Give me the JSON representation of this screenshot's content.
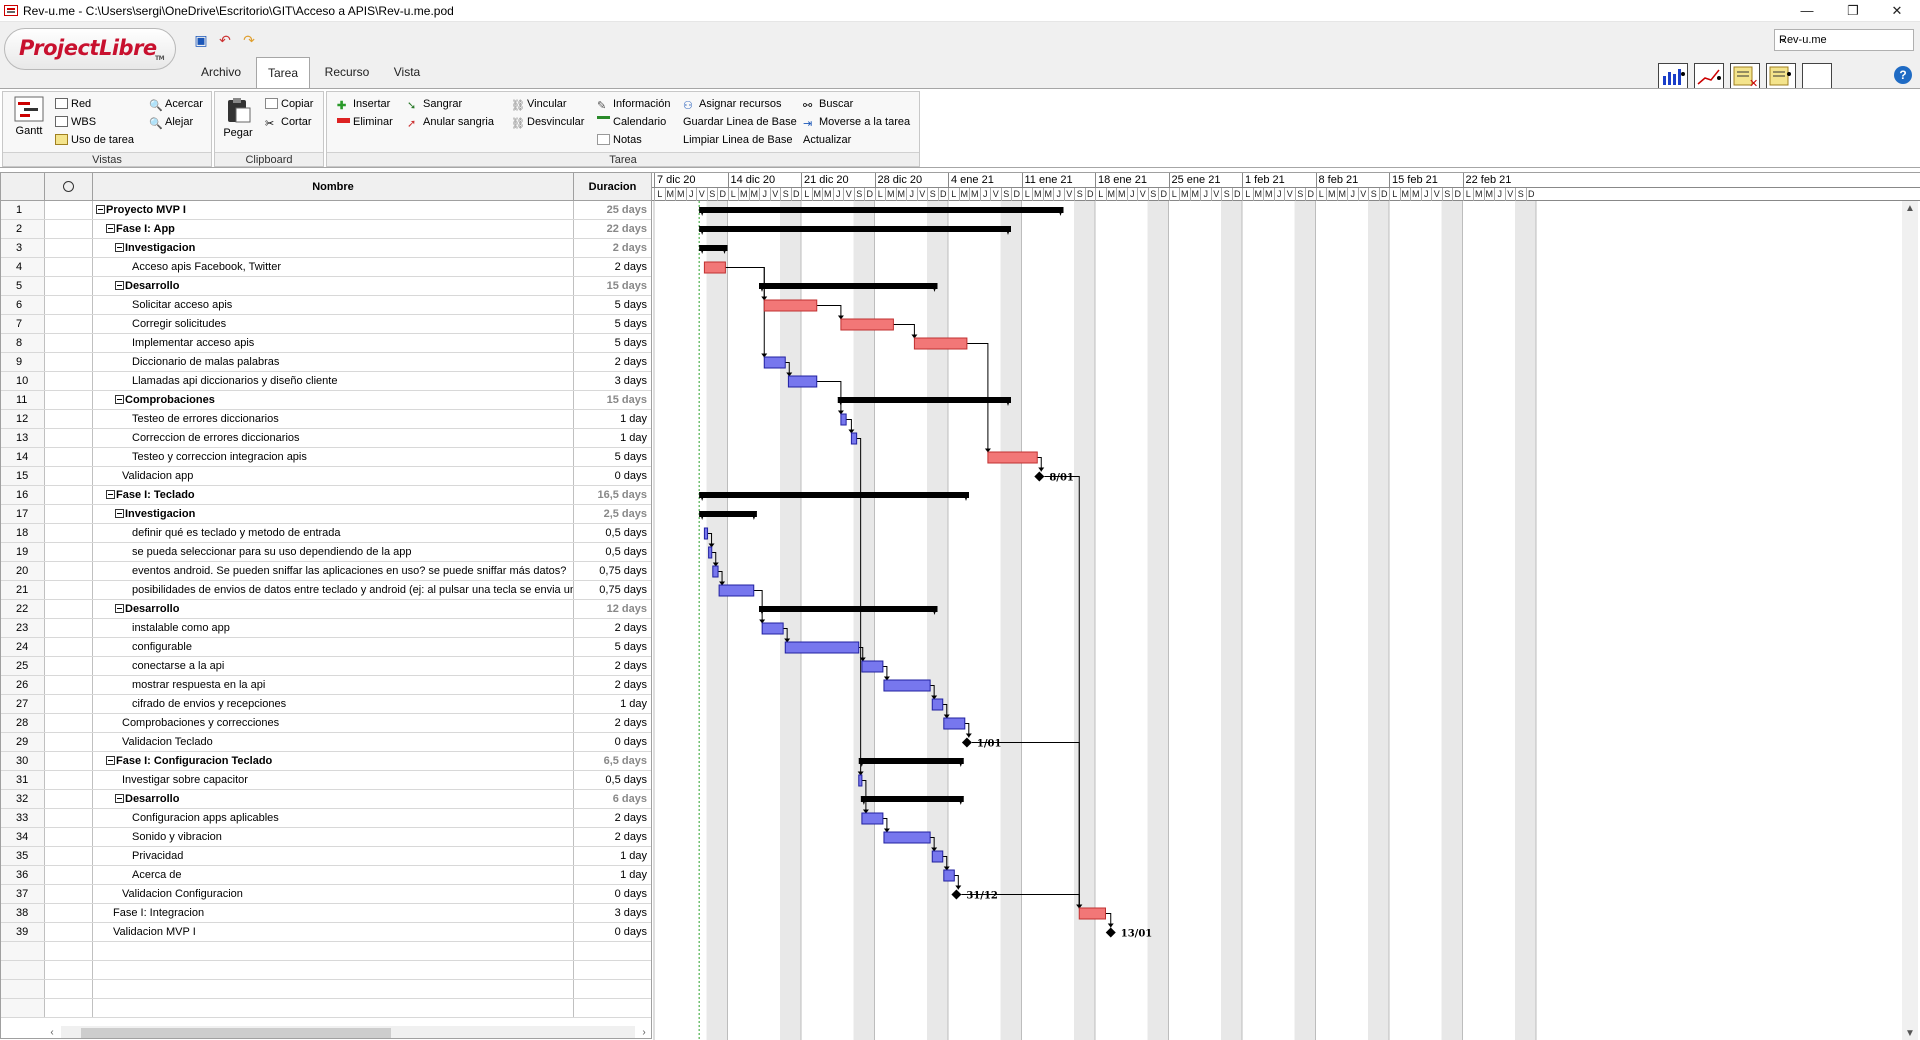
{
  "window": {
    "title": "Rev-u.me - C:\\Users\\sergi\\OneDrive\\Escritorio\\GIT\\Acceso a APIS\\Rev-u.me.pod",
    "controls": {
      "minimize": "—",
      "maximize": "❐",
      "close": "✕"
    }
  },
  "logo": {
    "text": "ProjectLibre",
    "tm": "TM"
  },
  "menu_tabs": [
    "Archivo",
    "Tarea",
    "Recurso",
    "Vista"
  ],
  "active_tab": "Tarea",
  "project_selector": {
    "value": "Rev-u.me"
  },
  "ribbon": {
    "vistas": {
      "label": "Vistas",
      "gantt": "Gantt",
      "red": "Red",
      "wbs": "WBS",
      "uso": "Uso de tarea",
      "acercar": "Acercar",
      "alejar": "Alejar"
    },
    "clipboard": {
      "label": "Clipboard",
      "pegar": "Pegar",
      "copiar": "Copiar",
      "cortar": "Cortar"
    },
    "tarea": {
      "label": "Tarea",
      "insertar": "Insertar",
      "eliminar": "Eliminar",
      "sangrar": "Sangrar",
      "anular": "Anular sangria",
      "vincular": "Vincular",
      "desvincular": "Desvincular",
      "informacion": "Información",
      "calendario": "Calendario",
      "notas": "Notas",
      "asignar": "Asignar recursos",
      "guardar": "Guardar Linea de Base",
      "limpiar": "Limpiar Linea de Base",
      "buscar": "Buscar",
      "moverse": "Moverse a la tarea",
      "actualizar": "Actualizar"
    }
  },
  "table": {
    "headers": {
      "name": "Nombre",
      "duration": "Duracion"
    },
    "rows": [
      {
        "id": "1",
        "name": "Proyecto MVP I",
        "dur": "25 days",
        "lvl": 0,
        "sum": true
      },
      {
        "id": "2",
        "name": "Fase I: App",
        "dur": "22 days",
        "lvl": 1,
        "sum": true
      },
      {
        "id": "3",
        "name": "Investigacion",
        "dur": "2 days",
        "lvl": 2,
        "sum": true
      },
      {
        "id": "4",
        "name": "Acceso apis Facebook, Twitter",
        "dur": "2 days",
        "lvl": 3,
        "sum": false
      },
      {
        "id": "5",
        "name": "Desarrollo",
        "dur": "15 days",
        "lvl": 2,
        "sum": true
      },
      {
        "id": "6",
        "name": "Solicitar acceso apis",
        "dur": "5 days",
        "lvl": 3,
        "sum": false
      },
      {
        "id": "7",
        "name": "Corregir solicitudes",
        "dur": "5 days",
        "lvl": 3,
        "sum": false
      },
      {
        "id": "8",
        "name": "Implementar acceso apis",
        "dur": "5 days",
        "lvl": 3,
        "sum": false
      },
      {
        "id": "9",
        "name": "Diccionario de malas palabras",
        "dur": "2 days",
        "lvl": 3,
        "sum": false
      },
      {
        "id": "10",
        "name": "Llamadas api diccionarios y diseño cliente",
        "dur": "3 days",
        "lvl": 3,
        "sum": false
      },
      {
        "id": "11",
        "name": "Comprobaciones",
        "dur": "15 days",
        "lvl": 2,
        "sum": true
      },
      {
        "id": "12",
        "name": "Testeo de errores diccionarios",
        "dur": "1 day",
        "lvl": 3,
        "sum": false
      },
      {
        "id": "13",
        "name": "Correccion de errores diccionarios",
        "dur": "1 day",
        "lvl": 3,
        "sum": false
      },
      {
        "id": "14",
        "name": "Testeo y correccion integracion apis",
        "dur": "5 days",
        "lvl": 3,
        "sum": false
      },
      {
        "id": "15",
        "name": "Validacion app",
        "dur": "0 days",
        "lvl": 2,
        "sum": false
      },
      {
        "id": "16",
        "name": "Fase I: Teclado",
        "dur": "16,5 days",
        "lvl": 1,
        "sum": true
      },
      {
        "id": "17",
        "name": "Investigacion",
        "dur": "2,5 days",
        "lvl": 2,
        "sum": true
      },
      {
        "id": "18",
        "name": "definir qué es teclado y metodo de entrada",
        "dur": "0,5 days",
        "lvl": 3,
        "sum": false
      },
      {
        "id": "19",
        "name": " se pueda seleccionar para su uso dependiendo de la app",
        "dur": "0,5 days",
        "lvl": 3,
        "sum": false
      },
      {
        "id": "20",
        "name": "eventos android. Se pueden sniffar las aplicaciones en uso? se puede sniffar más datos?",
        "dur": "0,75 days",
        "lvl": 3,
        "sum": false
      },
      {
        "id": "21",
        "name": "posibilidades de envios de datos entre teclado y android (ej: al pulsar una tecla se envia un u",
        "dur": "0,75 days",
        "lvl": 3,
        "sum": false
      },
      {
        "id": "22",
        "name": "Desarrollo",
        "dur": "12 days",
        "lvl": 2,
        "sum": true
      },
      {
        "id": "23",
        "name": "instalable como app",
        "dur": "2 days",
        "lvl": 3,
        "sum": false
      },
      {
        "id": "24",
        "name": "configurable",
        "dur": "5 days",
        "lvl": 3,
        "sum": false
      },
      {
        "id": "25",
        "name": "conectarse a la api",
        "dur": "2 days",
        "lvl": 3,
        "sum": false
      },
      {
        "id": "26",
        "name": "mostrar respuesta en la api",
        "dur": "2 days",
        "lvl": 3,
        "sum": false
      },
      {
        "id": "27",
        "name": "cifrado de envios y recepciones",
        "dur": "1 day",
        "lvl": 3,
        "sum": false
      },
      {
        "id": "28",
        "name": "Comprobaciones y correcciones",
        "dur": "2 days",
        "lvl": 2,
        "sum": false
      },
      {
        "id": "29",
        "name": "Validacion Teclado",
        "dur": "0 days",
        "lvl": 2,
        "sum": false
      },
      {
        "id": "30",
        "name": "Fase I: Configuracion Teclado",
        "dur": "6,5 days",
        "lvl": 1,
        "sum": true
      },
      {
        "id": "31",
        "name": "Investigar sobre capacitor",
        "dur": "0,5 days",
        "lvl": 2,
        "sum": false
      },
      {
        "id": "32",
        "name": "Desarrollo",
        "dur": "6 days",
        "lvl": 2,
        "sum": true
      },
      {
        "id": "33",
        "name": "Configuracion apps aplicables",
        "dur": "2 days",
        "lvl": 3,
        "sum": false
      },
      {
        "id": "34",
        "name": "Sonido y vibracion",
        "dur": "2 days",
        "lvl": 3,
        "sum": false
      },
      {
        "id": "35",
        "name": "Privacidad",
        "dur": "1 day",
        "lvl": 3,
        "sum": false
      },
      {
        "id": "36",
        "name": "Acerca de",
        "dur": "1 day",
        "lvl": 3,
        "sum": false
      },
      {
        "id": "37",
        "name": "Validacion Configuracion",
        "dur": "0 days",
        "lvl": 2,
        "sum": false
      },
      {
        "id": "38",
        "name": "Fase I: Integracion",
        "dur": "3 days",
        "lvl": 1,
        "sum": false
      },
      {
        "id": "39",
        "name": "Validacion MVP I",
        "dur": "0 days",
        "lvl": 1,
        "sum": false
      }
    ]
  },
  "timeline": {
    "weeks": [
      "7 dic 20",
      "14 dic 20",
      "21 dic 20",
      "28 dic 20",
      "4 ene 21",
      "11 ene 21",
      "18 ene 21",
      "25 ene 21",
      "1 feb 21",
      "8 feb 21",
      "15 feb 21",
      "22 feb 21"
    ],
    "day_letters": [
      "L",
      "M",
      "M",
      "J",
      "V",
      "S",
      "D"
    ]
  },
  "colors": {
    "critical": "#f27777",
    "normal": "#7777ee",
    "summary": "#000000",
    "weekend": "#e8e8e8"
  },
  "chart_data": {
    "type": "gantt",
    "time_unit": "days from Mon 7 dic 20",
    "tasks": [
      {
        "id": 1,
        "start": 4.3,
        "end": 39.0,
        "kind": "summary"
      },
      {
        "id": 2,
        "start": 4.3,
        "end": 34.0,
        "kind": "summary"
      },
      {
        "id": 3,
        "start": 4.3,
        "end": 7.0,
        "kind": "summary"
      },
      {
        "id": 4,
        "start": 4.8,
        "end": 6.8,
        "kind": "critical"
      },
      {
        "id": 5,
        "start": 10.0,
        "end": 27.0,
        "kind": "summary"
      },
      {
        "id": 6,
        "start": 10.5,
        "end": 15.5,
        "kind": "critical"
      },
      {
        "id": 7,
        "start": 17.8,
        "end": 22.8,
        "kind": "critical"
      },
      {
        "id": 8,
        "start": 24.8,
        "end": 29.8,
        "kind": "critical"
      },
      {
        "id": 9,
        "start": 10.5,
        "end": 12.5,
        "kind": "normal"
      },
      {
        "id": 10,
        "start": 12.8,
        "end": 15.5,
        "kind": "normal"
      },
      {
        "id": 11,
        "start": 17.5,
        "end": 34.0,
        "kind": "summary"
      },
      {
        "id": 12,
        "start": 17.8,
        "end": 18.3,
        "kind": "normal"
      },
      {
        "id": 13,
        "start": 18.8,
        "end": 19.3,
        "kind": "normal"
      },
      {
        "id": 14,
        "start": 31.8,
        "end": 36.5,
        "kind": "critical"
      },
      {
        "id": 15,
        "milestone": 36.7,
        "label": "8/01"
      },
      {
        "id": 16,
        "start": 4.3,
        "end": 30.0,
        "kind": "summary"
      },
      {
        "id": 17,
        "start": 4.3,
        "end": 9.8,
        "kind": "summary"
      },
      {
        "id": 18,
        "start": 4.8,
        "end": 5.1,
        "kind": "normal"
      },
      {
        "id": 19,
        "start": 5.2,
        "end": 5.5,
        "kind": "normal"
      },
      {
        "id": 20,
        "start": 5.6,
        "end": 6.1,
        "kind": "normal"
      },
      {
        "id": 21,
        "start": 6.2,
        "end": 9.5,
        "kind": "normal"
      },
      {
        "id": 22,
        "start": 10.0,
        "end": 27.0,
        "kind": "summary"
      },
      {
        "id": 23,
        "start": 10.3,
        "end": 12.3,
        "kind": "normal"
      },
      {
        "id": 24,
        "start": 12.5,
        "end": 19.5,
        "kind": "normal"
      },
      {
        "id": 25,
        "start": 19.8,
        "end": 21.8,
        "kind": "normal"
      },
      {
        "id": 26,
        "start": 21.9,
        "end": 26.3,
        "kind": "normal"
      },
      {
        "id": 27,
        "start": 26.5,
        "end": 27.5,
        "kind": "normal"
      },
      {
        "id": 28,
        "start": 27.6,
        "end": 29.6,
        "kind": "normal"
      },
      {
        "id": 29,
        "milestone": 29.8,
        "label": "1/01"
      },
      {
        "id": 30,
        "start": 19.5,
        "end": 29.5,
        "kind": "summary"
      },
      {
        "id": 31,
        "start": 19.5,
        "end": 19.8,
        "kind": "normal"
      },
      {
        "id": 32,
        "start": 19.7,
        "end": 29.5,
        "kind": "summary"
      },
      {
        "id": 33,
        "start": 19.8,
        "end": 21.8,
        "kind": "normal"
      },
      {
        "id": 34,
        "start": 21.9,
        "end": 26.3,
        "kind": "normal"
      },
      {
        "id": 35,
        "start": 26.5,
        "end": 27.5,
        "kind": "normal"
      },
      {
        "id": 36,
        "start": 27.6,
        "end": 28.6,
        "kind": "normal"
      },
      {
        "id": 37,
        "milestone": 28.8,
        "label": "31/12"
      },
      {
        "id": 38,
        "start": 40.5,
        "end": 43.0,
        "kind": "critical"
      },
      {
        "id": 39,
        "milestone": 43.5,
        "label": "13/01"
      }
    ],
    "links": [
      [
        4,
        6
      ],
      [
        4,
        9
      ],
      [
        6,
        7
      ],
      [
        7,
        8
      ],
      [
        8,
        14
      ],
      [
        9,
        10
      ],
      [
        10,
        12
      ],
      [
        12,
        13
      ],
      [
        14,
        15
      ],
      [
        18,
        19
      ],
      [
        19,
        20
      ],
      [
        20,
        21
      ],
      [
        21,
        23
      ],
      [
        23,
        24
      ],
      [
        24,
        25
      ],
      [
        25,
        26
      ],
      [
        26,
        27
      ],
      [
        27,
        28
      ],
      [
        28,
        29
      ],
      [
        31,
        33
      ],
      [
        33,
        34
      ],
      [
        34,
        35
      ],
      [
        35,
        36
      ],
      [
        36,
        37
      ],
      [
        15,
        38
      ],
      [
        29,
        38
      ],
      [
        37,
        38
      ],
      [
        38,
        39
      ],
      [
        13,
        31
      ]
    ]
  }
}
